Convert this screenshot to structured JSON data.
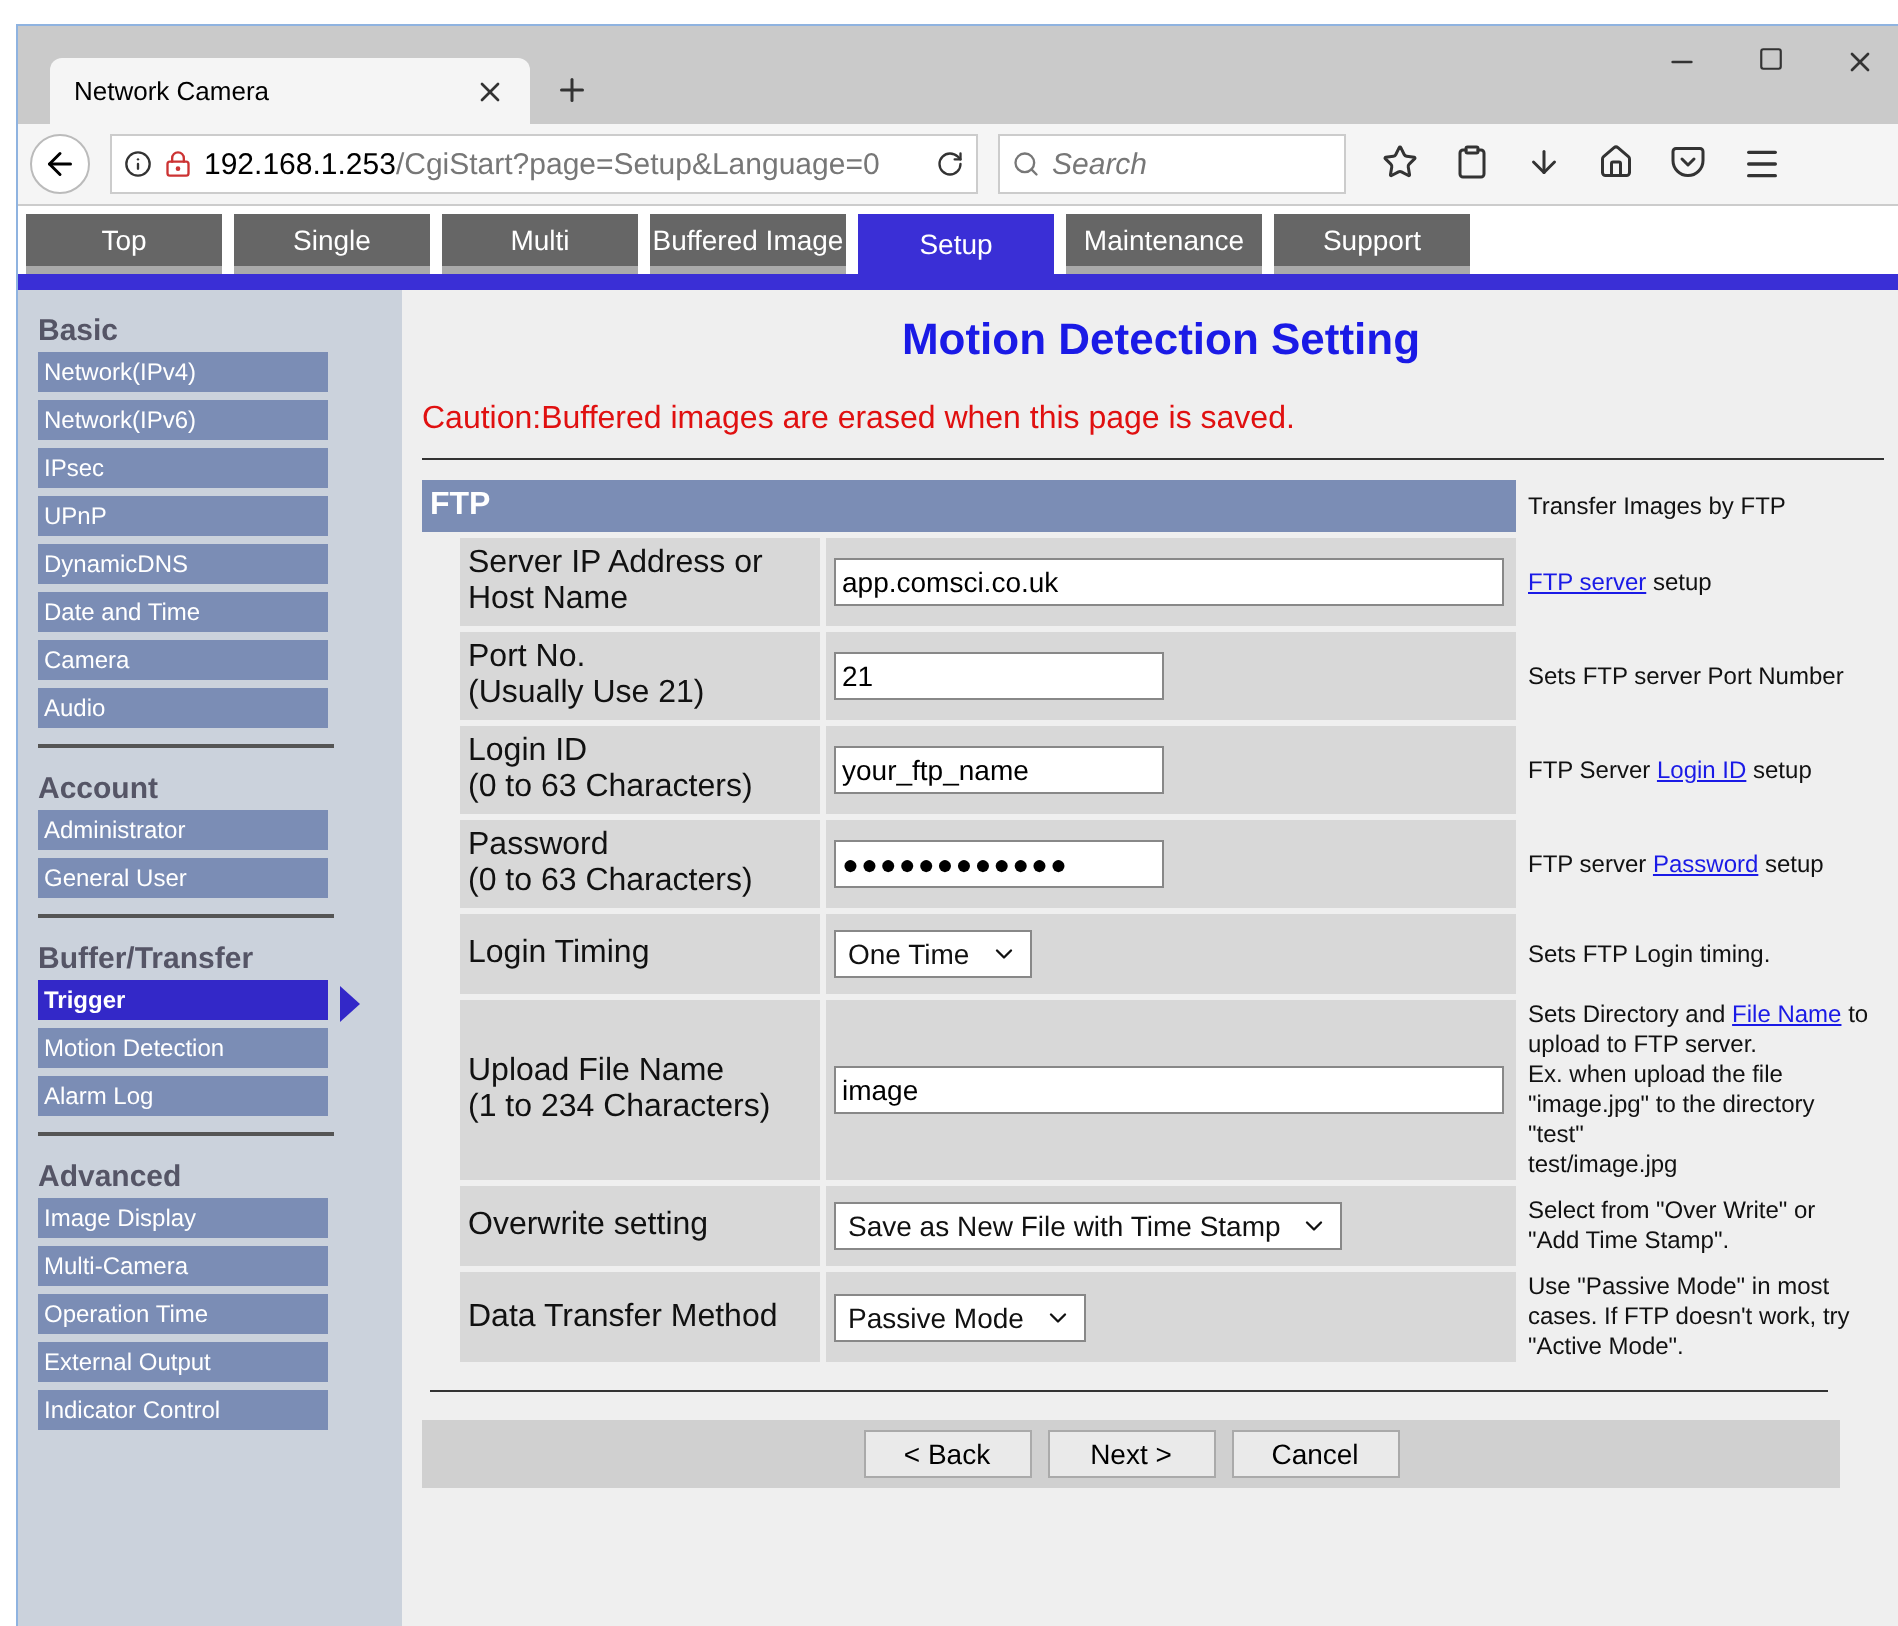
{
  "browser": {
    "tab_title": "Network Camera",
    "url_host": "192.168.1.253",
    "url_path": "/CgiStart?page=Setup&Language=0",
    "search_placeholder": "Search"
  },
  "nav_tabs": [
    {
      "label": "Top",
      "selected": false
    },
    {
      "label": "Single",
      "selected": false
    },
    {
      "label": "Multi",
      "selected": false
    },
    {
      "label": "Buffered Image",
      "selected": false
    },
    {
      "label": "Setup",
      "selected": true
    },
    {
      "label": "Maintenance",
      "selected": false
    },
    {
      "label": "Support",
      "selected": false
    }
  ],
  "sidebar": [
    {
      "heading": "Basic",
      "items": [
        {
          "label": "Network(IPv4)",
          "selected": false
        },
        {
          "label": "Network(IPv6)",
          "selected": false
        },
        {
          "label": "IPsec",
          "selected": false
        },
        {
          "label": "UPnP",
          "selected": false
        },
        {
          "label": "DynamicDNS",
          "selected": false
        },
        {
          "label": "Date and Time",
          "selected": false
        },
        {
          "label": "Camera",
          "selected": false
        },
        {
          "label": "Audio",
          "selected": false
        }
      ]
    },
    {
      "heading": "Account",
      "items": [
        {
          "label": "Administrator",
          "selected": false
        },
        {
          "label": "General User",
          "selected": false
        }
      ]
    },
    {
      "heading": "Buffer/Transfer",
      "items": [
        {
          "label": "Trigger",
          "selected": true
        },
        {
          "label": "Motion Detection",
          "selected": false
        },
        {
          "label": "Alarm Log",
          "selected": false
        }
      ]
    },
    {
      "heading": "Advanced",
      "items": [
        {
          "label": "Image Display",
          "selected": false
        },
        {
          "label": "Multi-Camera",
          "selected": false
        },
        {
          "label": "Operation Time",
          "selected": false
        },
        {
          "label": "External Output",
          "selected": false
        },
        {
          "label": "Indicator Control",
          "selected": false
        }
      ]
    }
  ],
  "page_title": "Motion Detection Setting",
  "caution": "Caution:Buffered images are erased when this page is saved.",
  "section": {
    "title": "FTP",
    "help": "Transfer Images by FTP"
  },
  "rows": [
    {
      "kind": "text",
      "label": [
        "Server IP Address or",
        "Host Name"
      ],
      "value": "app.comsci.co.uk",
      "help": [
        [
          {
            "text": "FTP server",
            "link": true
          },
          {
            "text": " setup",
            "link": false
          }
        ]
      ]
    },
    {
      "kind": "text",
      "label": [
        "Port No.",
        "(Usually Use 21)"
      ],
      "value": "21",
      "help": [
        [
          {
            "text": "Sets FTP server Port Number",
            "link": false
          }
        ]
      ]
    },
    {
      "kind": "text",
      "label": [
        "Login ID",
        "(0 to 63 Characters)"
      ],
      "value": "your_ftp_name",
      "help": [
        [
          {
            "text": "FTP Server ",
            "link": false
          },
          {
            "text": "Login ID",
            "link": true
          },
          {
            "text": " setup",
            "link": false
          }
        ]
      ]
    },
    {
      "kind": "password",
      "label": [
        "Password",
        "(0 to 63 Characters)"
      ],
      "value": "●●●●●●●●●●●●",
      "help": [
        [
          {
            "text": "FTP server ",
            "link": false
          },
          {
            "text": "Password",
            "link": true
          },
          {
            "text": " setup",
            "link": false
          }
        ]
      ]
    },
    {
      "kind": "select",
      "label": [
        "Login Timing"
      ],
      "value": "One Time",
      "help": [
        [
          {
            "text": "Sets FTP Login timing.",
            "link": false
          }
        ]
      ]
    },
    {
      "kind": "text",
      "label": [
        "Upload File Name",
        "(1 to 234 Characters)"
      ],
      "value": "image",
      "help": [
        [
          {
            "text": "Sets Directory and ",
            "link": false
          },
          {
            "text": "File Name",
            "link": true
          },
          {
            "text": " to",
            "link": false
          }
        ],
        [
          {
            "text": "upload to FTP server.",
            "link": false
          }
        ],
        [
          {
            "text": "Ex. when upload the file",
            "link": false
          }
        ],
        [
          {
            "text": "\"image.jpg\" to the directory",
            "link": false
          }
        ],
        [
          {
            "text": "\"test\"",
            "link": false
          }
        ],
        [
          {
            "text": "test/image.jpg",
            "link": false
          }
        ]
      ]
    },
    {
      "kind": "select",
      "label": [
        "Overwrite setting"
      ],
      "value": "Save as New File with Time Stamp",
      "help": [
        [
          {
            "text": "Select from \"Over Write\" or",
            "link": false
          }
        ],
        [
          {
            "text": "\"Add Time Stamp\".",
            "link": false
          }
        ]
      ]
    },
    {
      "kind": "select",
      "label": [
        "Data Transfer Method"
      ],
      "value": "Passive Mode",
      "help": [
        [
          {
            "text": "Use \"Passive Mode\" in most",
            "link": false
          }
        ],
        [
          {
            "text": "cases. If FTP doesn't work, try",
            "link": false
          }
        ],
        [
          {
            "text": "\"Active Mode\".",
            "link": false
          }
        ]
      ]
    }
  ],
  "buttons": [
    "< Back",
    "Next >",
    "Cancel"
  ]
}
